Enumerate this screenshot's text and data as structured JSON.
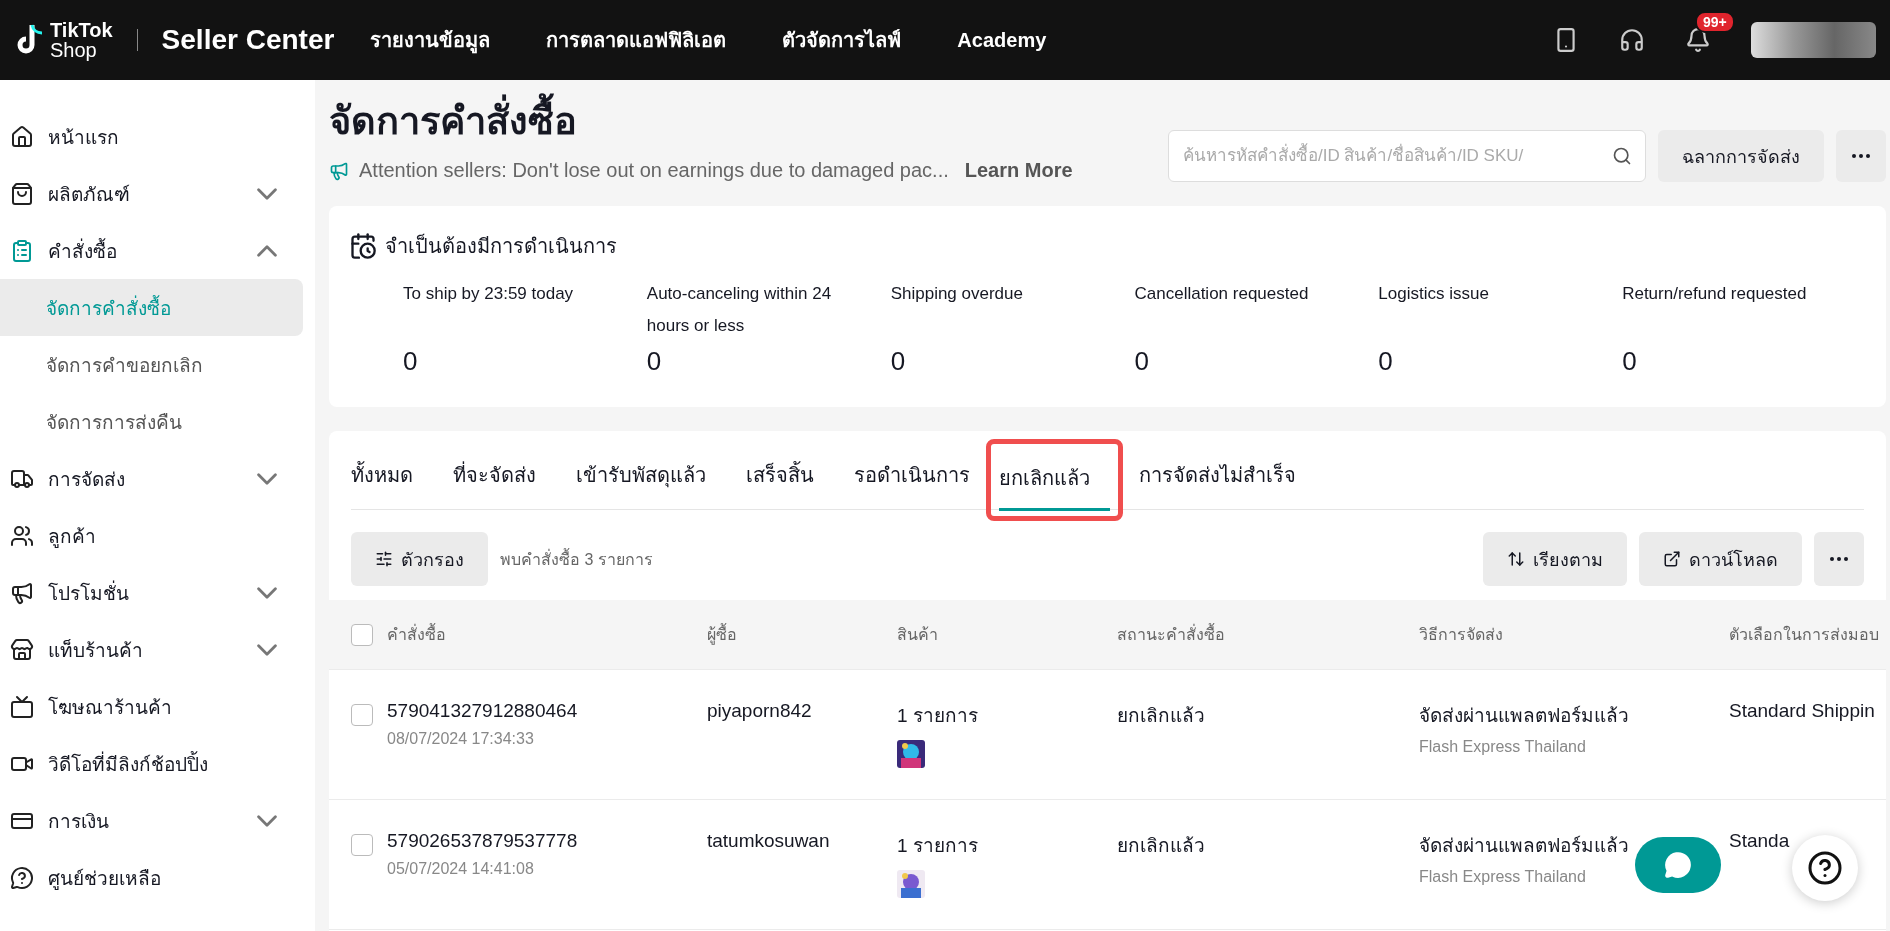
{
  "topbar": {
    "logo_top": "TikTok",
    "logo_bottom": "Shop",
    "product": "Seller Center",
    "nav": [
      "รายงานข้อมูล",
      "การตลาดแอฟฟิลิเอต",
      "ตัวจัดการไลฟ์",
      "Academy"
    ],
    "notification_badge": "99+"
  },
  "sidebar": {
    "items": [
      {
        "label": "หน้าแรก"
      },
      {
        "label": "ผลิตภัณฑ์",
        "expanded": false
      },
      {
        "label": "คำสั่งซื้อ",
        "expanded": true,
        "children": [
          {
            "label": "จัดการคำสั่งซื้อ",
            "selected": true
          },
          {
            "label": "จัดการคำขอยกเลิก",
            "selected": false
          },
          {
            "label": "จัดการการส่งคืน",
            "selected": false
          }
        ]
      },
      {
        "label": "การจัดส่ง",
        "expanded": false
      },
      {
        "label": "ลูกค้า"
      },
      {
        "label": "โปรโมชั่น",
        "expanded": false
      },
      {
        "label": "แท็บร้านค้า",
        "expanded": false
      },
      {
        "label": "โฆษณาร้านค้า"
      },
      {
        "label": "วิดีโอที่มีลิงก์ช้อปปิ้ง"
      },
      {
        "label": "การเงิน",
        "expanded": false
      },
      {
        "label": "ศูนย์ช่วยเหลือ"
      }
    ]
  },
  "page": {
    "title": "จัดการคำสั่งซื้อ",
    "notice": "Attention sellers: Don't lose out on earnings due to damaged pac...",
    "notice_link": "Learn More",
    "search": {
      "placeholder": "ค้นหารหัสคำสั่งซื้อ/ID สินค้า/ชื่อสินค้า/ID SKU/"
    },
    "label_button": "ฉลากการจัดส่ง"
  },
  "action_card": {
    "title": "จำเป็นต้องมีการดำเนินการ",
    "stats": [
      {
        "label": "To ship by 23:59 today",
        "value": "0"
      },
      {
        "label": "Auto-canceling within 24 hours or less",
        "value": "0"
      },
      {
        "label": "Shipping overdue",
        "value": "0"
      },
      {
        "label": "Cancellation requested",
        "value": "0"
      },
      {
        "label": "Logistics issue",
        "value": "0"
      },
      {
        "label": "Return/refund requested",
        "value": "0"
      }
    ]
  },
  "orders": {
    "tabs": [
      {
        "label": "ทั้งหมด",
        "selected": false,
        "highlighted": false
      },
      {
        "label": "ที่จะจัดส่ง",
        "selected": false,
        "highlighted": false
      },
      {
        "label": "เข้ารับพัสดุแล้ว",
        "selected": false,
        "highlighted": false
      },
      {
        "label": "เสร็จสิ้น",
        "selected": false,
        "highlighted": false
      },
      {
        "label": "รอดำเนินการ",
        "selected": false,
        "highlighted": false
      },
      {
        "label": "ยกเลิกแล้ว",
        "selected": true,
        "highlighted": true
      },
      {
        "label": "การจัดส่งไม่สำเร็จ",
        "selected": false,
        "highlighted": false
      }
    ],
    "filter_button": "ตัวกรอง",
    "count": "พบคำสั่งซื้อ 3 รายการ",
    "sort_button": "เรียงตาม",
    "download_button": "ดาวน์โหลด",
    "table": {
      "columns": [
        "คำสั่งซื้อ",
        "ผู้ซื้อ",
        "สินค้า",
        "สถานะคำสั่งซื้อ",
        "วิธีการจัดส่ง",
        "ตัวเลือกในการส่งมอบ"
      ],
      "select_all_checked": false,
      "rows": [
        {
          "checked": false,
          "order_id": "579041327912880464",
          "date": "08/07/2024 17:34:33",
          "buyer": "piyaporn842",
          "items": "1 รายการ",
          "status": "ยกเลิกแล้ว",
          "shipping": "จัดส่งผ่านแพลตฟอร์มแล้ว",
          "carrier": "Flash Express Thailand",
          "option": "Standard Shippin"
        },
        {
          "checked": false,
          "order_id": "579026537879537778",
          "date": "05/07/2024 14:41:08",
          "buyer": "tatumkosuwan",
          "items": "1 รายการ",
          "status": "ยกเลิกแล้ว",
          "shipping": "จัดส่งผ่านแพลตฟอร์มแล้ว",
          "carrier": "Flash Express Thailand",
          "option": "Standa"
        }
      ]
    }
  }
}
